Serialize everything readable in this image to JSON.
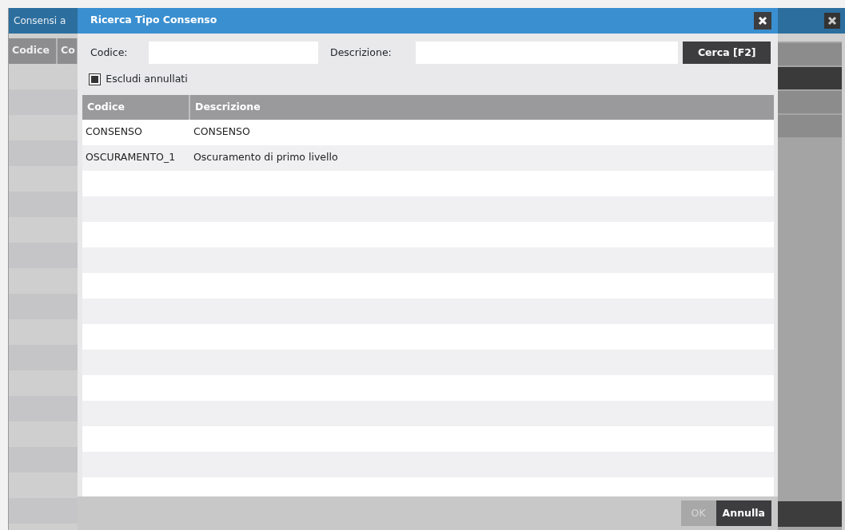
{
  "background_window": {
    "title": "Consensi a",
    "columns": [
      "Codice",
      "Co"
    ]
  },
  "dialog": {
    "title": "Ricerca Tipo Consenso",
    "fields": [
      {
        "label": "Codice:"
      },
      {
        "label": "Descrizione:"
      }
    ],
    "search_button": {
      "label": "Cerca [F2]"
    },
    "checkbox": {
      "label": "Escludi annullati",
      "checked": true
    },
    "table": {
      "columns": [
        "Codice",
        "Descrizione"
      ],
      "rows": [
        [
          "CONSENSO",
          "CONSENSO"
        ],
        [
          "OSCURAMENTO_1",
          "Oscuramento di primo livello"
        ]
      ]
    },
    "buttons": [
      {
        "label": "OK",
        "disabled": true
      },
      {
        "label": "Annulla",
        "disabled": false
      }
    ]
  }
}
